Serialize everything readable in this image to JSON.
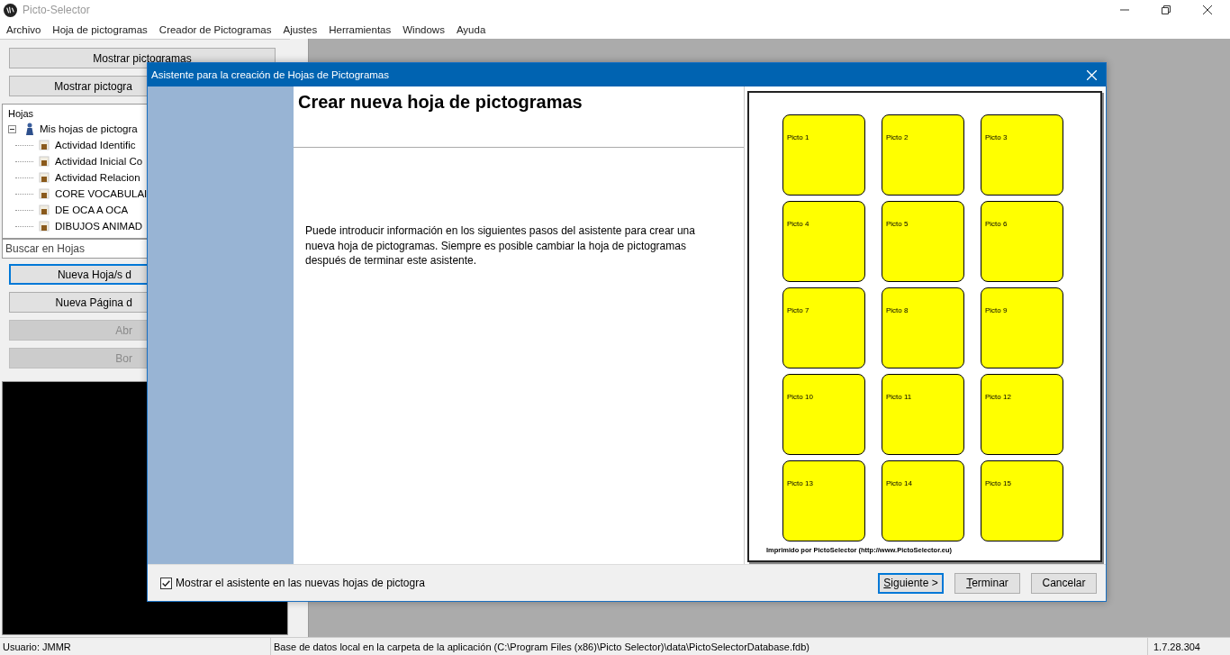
{
  "window": {
    "title": "Picto-Selector"
  },
  "menu": [
    "Archivo",
    "Hoja de pictogramas",
    "Creador de Pictogramas",
    "Ajustes",
    "Herramientas",
    "Windows",
    "Ayuda"
  ],
  "top_buttons": [
    {
      "label": "Mostrar pictogramas",
      "disabled": false
    },
    {
      "label": "Mostrar pictogra",
      "disabled": false
    }
  ],
  "tree": {
    "header": "Hojas",
    "items": [
      {
        "label": "Mis hojas de pictogra",
        "expanded": true,
        "children": [
          {
            "label": "Actividad Identific"
          },
          {
            "label": "Actividad Inicial Co"
          },
          {
            "label": "Actividad Relacion"
          },
          {
            "label": "CORE VOCABULAI"
          },
          {
            "label": "DE OCA A OCA"
          },
          {
            "label": "DIBUJOS ANIMAD"
          }
        ]
      }
    ]
  },
  "search": {
    "placeholder": "Buscar en Hojas"
  },
  "action_buttons": [
    {
      "label": "Nueva Hoja/s d",
      "disabled": false,
      "focused": true
    },
    {
      "label": "Nueva Página d",
      "disabled": false,
      "focused": false
    },
    {
      "label": "Abr",
      "disabled": true,
      "focused": false
    },
    {
      "label": "Bor",
      "disabled": true,
      "focused": false
    }
  ],
  "dialog": {
    "title": "Asistente para la creación de Hojas de Pictogramas",
    "heading": "Crear nueva hoja de pictogramas",
    "text": "Puede introducir información en los siguientes pasos del asistente para crear una nueva hoja de pictogramas. Siempre es posible cambiar la hoja de pictogramas después de terminar este asistente.",
    "preview": {
      "cards": [
        "Picto 1",
        "Picto 2",
        "Picto 3",
        "Picto 4",
        "Picto 5",
        "Picto 6",
        "Picto 7",
        "Picto 8",
        "Picto 9",
        "Picto 10",
        "Picto 11",
        "Picto 12",
        "Picto 13",
        "Picto 14",
        "Picto 15"
      ],
      "footer": "Imprimido por PictoSelector (http://www.PictoSelector.eu)"
    },
    "checkbox": {
      "label": "Mostrar el asistente en las nuevas hojas de pictogra",
      "checked": true
    },
    "buttons": [
      {
        "label": "Siguiente >",
        "default": true,
        "mnemonic": true
      },
      {
        "label": "Terminar",
        "default": false,
        "mnemonic": true
      },
      {
        "label": "Cancelar",
        "default": false,
        "mnemonic": false
      }
    ]
  },
  "status_bar": [
    "Usuario: JMMR",
    "Base de datos local en la carpeta de la aplicación (C:\\Program Files (x86)\\Picto Selector)\\data\\PictoSelectorDatabase.fdb)",
    "1.7.28.304"
  ]
}
